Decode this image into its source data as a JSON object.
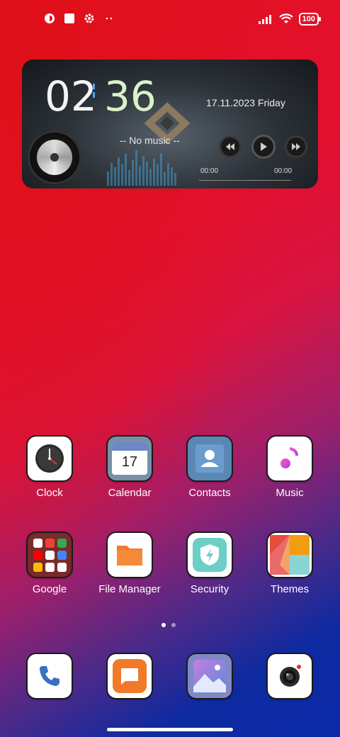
{
  "status_bar": {
    "battery": "100",
    "left_icons": [
      "app-icon",
      "square-icon",
      "settings-icon",
      "more-icon"
    ],
    "right_icons": [
      "signal-icon",
      "wifi-icon",
      "battery-icon"
    ]
  },
  "widget": {
    "hour": "02",
    "minute": "36",
    "date": "17.11.2023 Friday",
    "track": "-- No music --",
    "elapsed": "00:00",
    "duration": "00:00"
  },
  "apps": [
    {
      "label": "Clock",
      "icon": "clock-icon"
    },
    {
      "label": "Calendar",
      "icon": "calendar-icon",
      "day": "17"
    },
    {
      "label": "Contacts",
      "icon": "contacts-icon"
    },
    {
      "label": "Music",
      "icon": "music-icon"
    },
    {
      "label": "Google",
      "icon": "google-folder-icon"
    },
    {
      "label": "File Manager",
      "icon": "folder-icon"
    },
    {
      "label": "Security",
      "icon": "shield-icon"
    },
    {
      "label": "Themes",
      "icon": "themes-icon"
    }
  ],
  "dock": [
    {
      "icon": "phone-icon"
    },
    {
      "icon": "messages-icon"
    },
    {
      "icon": "gallery-icon"
    },
    {
      "icon": "camera-icon"
    }
  ],
  "pager": {
    "pages": 2,
    "current": 1
  },
  "colors": {
    "accent_red": "#e3101c",
    "accent_blue": "#0a2aa8"
  }
}
